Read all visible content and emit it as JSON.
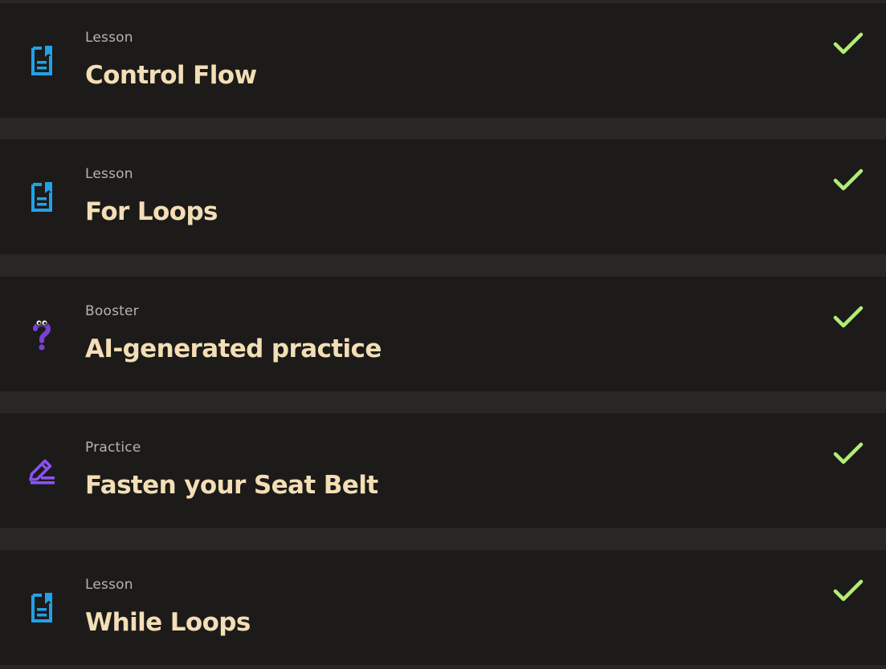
{
  "items": [
    {
      "type": "Lesson",
      "title": "Control Flow",
      "icon": "lesson-icon",
      "completed": true
    },
    {
      "type": "Lesson",
      "title": "For Loops",
      "icon": "lesson-icon",
      "completed": true
    },
    {
      "type": "Booster",
      "title": "AI-generated practice",
      "icon": "booster-icon",
      "completed": true
    },
    {
      "type": "Practice",
      "title": "Fasten your Seat Belt",
      "icon": "practice-icon",
      "completed": true
    },
    {
      "type": "Lesson",
      "title": "While Loops",
      "icon": "lesson-icon",
      "completed": true
    }
  ],
  "colors": {
    "background": "#282725",
    "card": "#1c1b1a",
    "title": "#f3deb6",
    "type_label": "#b9b3a9",
    "check": "#b4ed76",
    "lesson_icon": "#21a2e6",
    "booster_icon": "#7a3fd4",
    "practice_icon": "#8a52f0"
  }
}
